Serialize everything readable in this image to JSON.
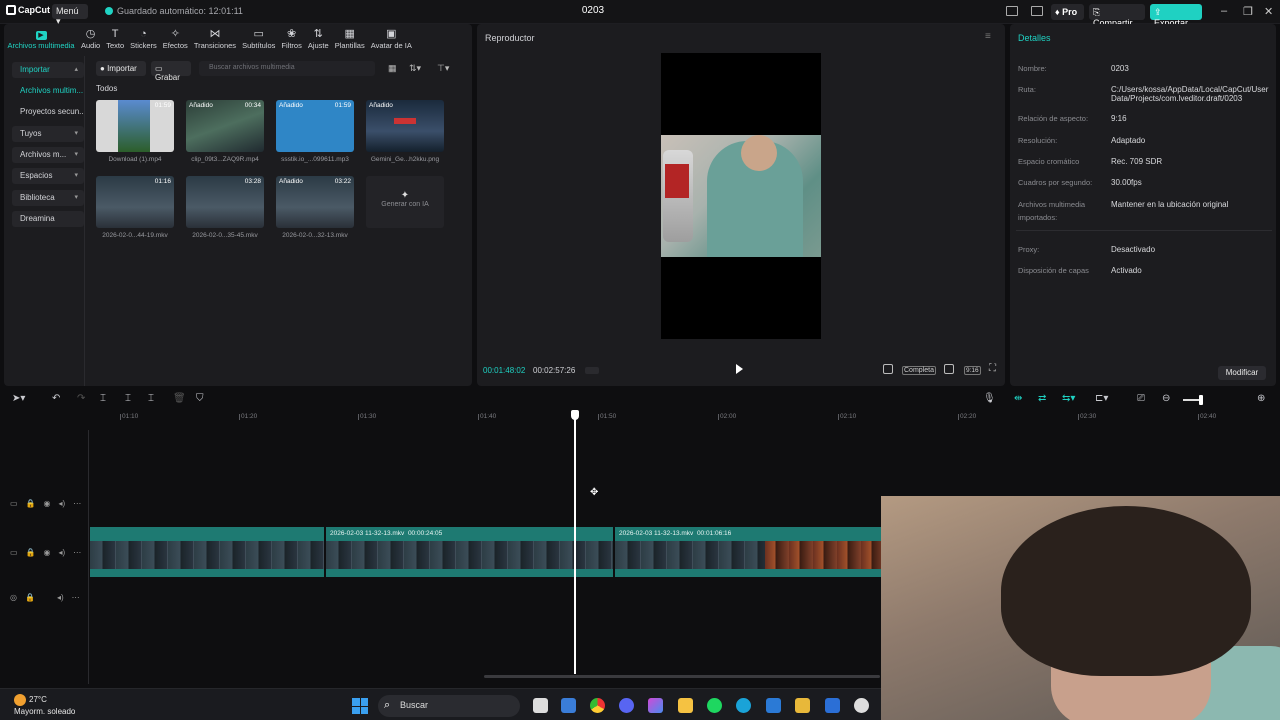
{
  "titlebar": {
    "logo": "CapCut",
    "menu": "Menú",
    "autosave": "Guardado automático: 12:01:11",
    "project": "0203",
    "pro": "Pro",
    "share": "Compartir",
    "export": "Exportar"
  },
  "tools": [
    {
      "label": "Archivos multimedia",
      "icon": "media-icon"
    },
    {
      "label": "Audio",
      "icon": "audio-icon"
    },
    {
      "label": "Texto",
      "icon": "text-icon"
    },
    {
      "label": "Stickers",
      "icon": "sticker-icon"
    },
    {
      "label": "Efectos",
      "icon": "effects-icon"
    },
    {
      "label": "Transiciones",
      "icon": "transitions-icon"
    },
    {
      "label": "Subtítulos",
      "icon": "subtitles-icon"
    },
    {
      "label": "Filtros",
      "icon": "filters-icon"
    },
    {
      "label": "Ajuste",
      "icon": "adjust-icon"
    },
    {
      "label": "Plantillas",
      "icon": "templates-icon"
    },
    {
      "label": "Avatar de IA",
      "icon": "avatar-icon"
    }
  ],
  "sidenav": {
    "importar": "Importar",
    "archivos": "Archivos multim...",
    "proyectos": "Proyectos secun...",
    "tuyos": "Tuyos",
    "archivos_m": "Archivos m...",
    "espacios": "Espacios",
    "biblioteca": "Biblioteca",
    "dreamina": "Dreamina"
  },
  "media": {
    "import_btn": "Importar",
    "record_btn": "Grabar",
    "search_placeholder": "Buscar archivos multimedia",
    "section": "Todos",
    "added_label": "Añadido",
    "items": [
      {
        "name": "Download (1).mp4",
        "duration": "01:59",
        "added": false
      },
      {
        "name": "clip_09t3...ZAQ9R.mp4",
        "duration": "00:34",
        "added": true
      },
      {
        "name": "ssstik.io_...099611.mp3",
        "duration": "01:59",
        "added": true
      },
      {
        "name": "Gemini_Ge...h2kku.png",
        "duration": "",
        "added": true
      },
      {
        "name": "2026-02-0...44-19.mkv",
        "duration": "01:16",
        "added": false
      },
      {
        "name": "2026-02-0...35-45.mkv",
        "duration": "03:28",
        "added": false
      },
      {
        "name": "2026-02-0...32-13.mkv",
        "duration": "03:22",
        "added": true
      }
    ],
    "generate_ai": "Generar con IA"
  },
  "player": {
    "title": "Reproductor",
    "current_time": "00:01:48:02",
    "total_time": "00:02:57:26",
    "completa": "Completa",
    "ratio": "9:16"
  },
  "details": {
    "title": "Detalles",
    "rows": [
      {
        "label": "Nombre:",
        "value": "0203"
      },
      {
        "label": "Ruta:",
        "value": "C:/Users/kossa/AppData/Local/CapCut/User Data/Projects/com.lveditor.draft/0203"
      },
      {
        "label": "Relación de aspecto:",
        "value": "9:16"
      },
      {
        "label": "Resolución:",
        "value": "Adaptado"
      },
      {
        "label": "Espacio cromático",
        "value": "Rec. 709 SDR"
      },
      {
        "label": "Cuadros por segundo:",
        "value": "30.00fps"
      },
      {
        "label": "Archivos multimedia importados:",
        "value": "Mantener en la ubicación original"
      },
      {
        "label": "Proxy:",
        "value": "Desactivado"
      },
      {
        "label": "Disposición de capas",
        "value": "Activado"
      }
    ],
    "modify": "Modificar"
  },
  "timeline": {
    "ruler": [
      "01:10",
      "01:20",
      "01:30",
      "01:40",
      "01:50",
      "02:00",
      "02:10",
      "02:20",
      "02:30",
      "02:40"
    ],
    "clips": [
      {
        "name": "2026-02-03 11-32-13.mkv",
        "duration": "00:00:24:05"
      },
      {
        "name": "2026-02-03 11-32-13.mkv",
        "duration": "00:01:06:16"
      }
    ]
  },
  "taskbar": {
    "temp": "27°C",
    "weather": "Mayorm. soleado",
    "search": "Buscar"
  }
}
